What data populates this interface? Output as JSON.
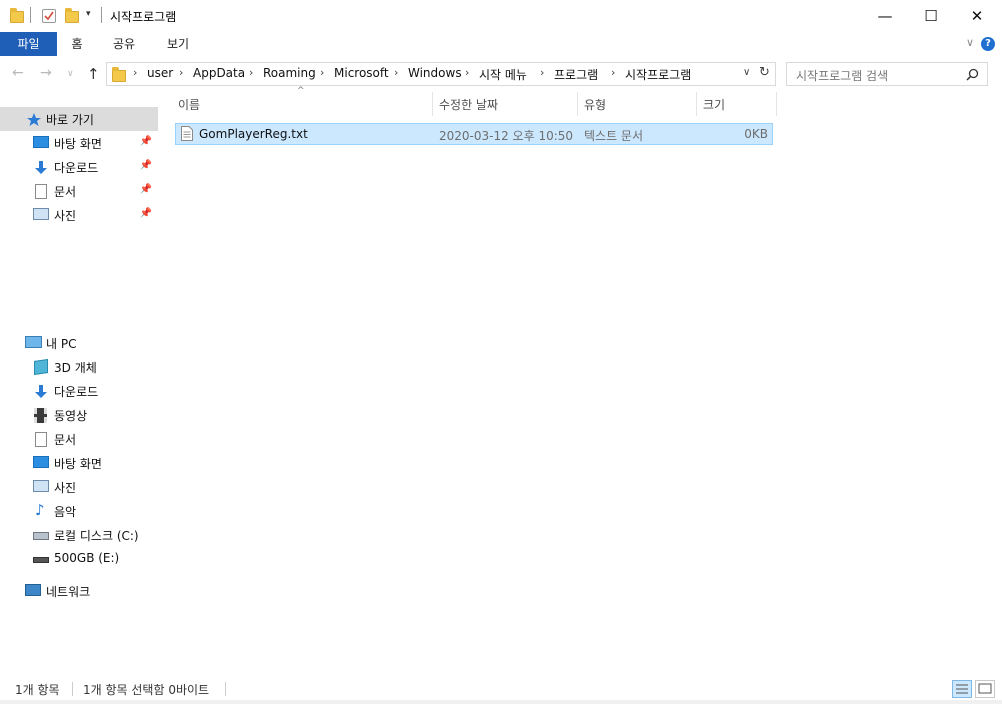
{
  "window": {
    "title": "시작프로그램",
    "controls": {
      "minimize": "—",
      "maximize": "☐",
      "close": "✕"
    }
  },
  "ribbon": {
    "tabs": [
      "파일",
      "홈",
      "공유",
      "보기"
    ],
    "help_glyph": "?",
    "collapse_glyph": "∨"
  },
  "nav_buttons": {
    "back": "←",
    "forward": "→",
    "recent": "∨",
    "up": "↑"
  },
  "address": {
    "crumbs": [
      "user",
      "AppData",
      "Roaming",
      "Microsoft",
      "Windows",
      "시작 메뉴",
      "프로그램",
      "시작프로그램"
    ],
    "separator": "›",
    "dropdown": "∨",
    "refresh": "↻"
  },
  "search": {
    "placeholder": "시작프로그램 검색",
    "icon": "search-icon"
  },
  "navpane": {
    "quick_access": {
      "label": "바로 가기",
      "items": [
        {
          "label": "바탕 화면",
          "icon": "desktop-icon",
          "pinned": true
        },
        {
          "label": "다운로드",
          "icon": "download-icon",
          "pinned": true
        },
        {
          "label": "문서",
          "icon": "document-icon",
          "pinned": true
        },
        {
          "label": "사진",
          "icon": "pictures-icon",
          "pinned": true
        }
      ]
    },
    "this_pc": {
      "label": "내 PC",
      "items": [
        {
          "label": "3D 개체",
          "icon": "3d-objects-icon"
        },
        {
          "label": "다운로드",
          "icon": "download-icon"
        },
        {
          "label": "동영상",
          "icon": "video-icon"
        },
        {
          "label": "문서",
          "icon": "document-icon"
        },
        {
          "label": "바탕 화면",
          "icon": "desktop-icon"
        },
        {
          "label": "사진",
          "icon": "pictures-icon"
        },
        {
          "label": "음악",
          "icon": "music-icon"
        },
        {
          "label": "로컬 디스크 (C:)",
          "icon": "local-disk-icon"
        },
        {
          "label": "500GB (E:)",
          "icon": "drive-icon"
        }
      ]
    },
    "network": {
      "label": "네트워크",
      "icon": "network-icon"
    }
  },
  "columns": {
    "name": "이름",
    "modified": "수정한 날짜",
    "type": "유형",
    "size": "크기",
    "sort_glyph": "^"
  },
  "files": [
    {
      "name": "GomPlayerReg.txt",
      "modified": "2020-03-12 오후 10:50",
      "type": "텍스트 문서",
      "size": "0KB",
      "selected": true,
      "icon": "text-file-icon"
    }
  ],
  "status": {
    "count": "1개 항목",
    "selection": "1개 항목 선택함 0바이트"
  },
  "colors": {
    "accent": "#1f5fb8",
    "selection": "#cce8ff",
    "selection_border": "#99d1ff",
    "nav_selected": "#dcdcdc"
  }
}
